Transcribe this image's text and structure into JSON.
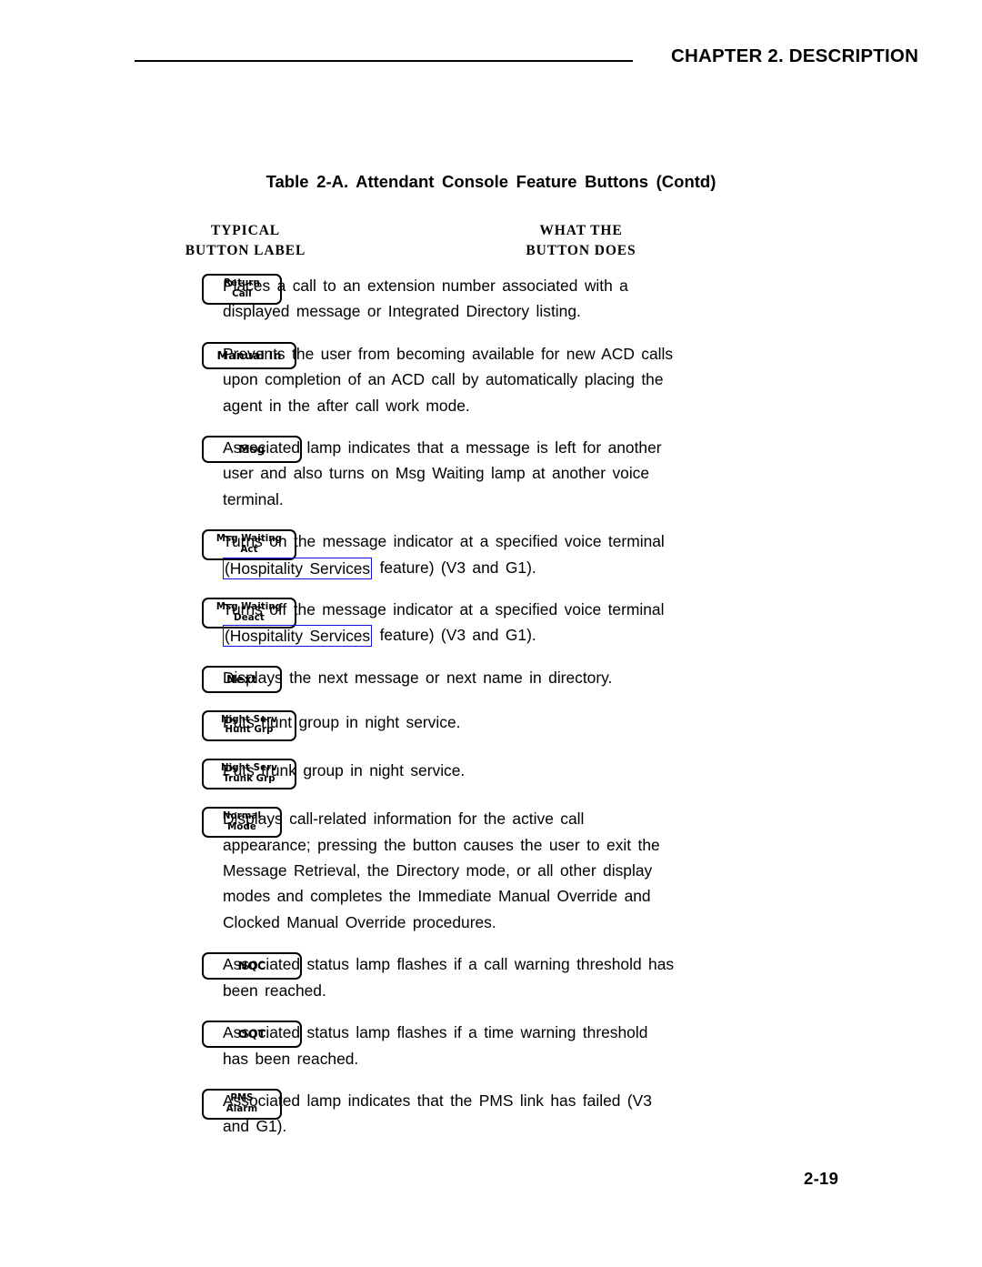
{
  "header": {
    "chapter_title": "CHAPTER 2. DESCRIPTION"
  },
  "table": {
    "caption": "Table 2-A. Attendant Console Feature Buttons (Contd)",
    "columns": {
      "left": "TYPICAL\nBUTTON LABEL",
      "right": "WHAT THE\nBUTTON DOES"
    },
    "link_color": "#1111dd",
    "rows": [
      {
        "button_lines": [
          "Return",
          "Call"
        ],
        "button_style": "two-line",
        "desc_lines": [
          "Places a call to an extension number associated with a",
          "displayed message or Integrated Directory listing."
        ]
      },
      {
        "button_lines": [
          "Manual In"
        ],
        "button_style": "one-line",
        "desc_lines": [
          "Prevents the user from becoming available for new ACD calls",
          "upon completion of an ACD call by automatically placing the",
          "agent in the after call work mode."
        ]
      },
      {
        "button_lines": [
          "Msg"
        ],
        "button_style": "one-line",
        "desc_lines": [
          "Associated lamp indicates that a message is left for another",
          "user and also turns on Msg Waiting lamp at another voice",
          "terminal."
        ]
      },
      {
        "button_lines": [
          "Msg Waiting",
          "Act"
        ],
        "button_style": "two-line",
        "desc_lines": [
          "Turns on the message indicator at a specified voice terminal"
        ],
        "linked_line": {
          "boxed": "(Hospitality Services",
          "after": " feature) (V3 and G1)."
        }
      },
      {
        "button_lines": [
          "Msg Waiting",
          "Deact"
        ],
        "button_style": "two-line",
        "desc_lines": [
          "Turns off the message indicator at a specified voice terminal"
        ],
        "linked_line": {
          "boxed": "(Hospitality Services",
          "after": " feature) (V3 and G1)."
        }
      },
      {
        "button_lines": [
          "Next"
        ],
        "button_style": "one-line",
        "desc_lines": [
          "Displays the next message or next name in directory."
        ]
      },
      {
        "button_lines": [
          "Night Serv",
          "Hunt Grp"
        ],
        "button_style": "two-line",
        "desc_lines": [
          "Puts hunt group in night service."
        ]
      },
      {
        "button_lines": [
          "Night Serv",
          "Trunk Grp"
        ],
        "button_style": "two-line",
        "desc_lines": [
          "Puts trunk group in night service."
        ]
      },
      {
        "button_lines": [
          "Normal",
          "Mode"
        ],
        "button_style": "two-line",
        "desc_lines": [
          "Displays call-related information for the active call",
          "appearance; pressing the button causes the user to exit the",
          "Message Retrieval, the Directory mode, or all other display",
          "modes and completes the Immediate Manual Override and",
          "Clocked Manual Override procedures."
        ]
      },
      {
        "button_lines": [
          "NQC"
        ],
        "button_style": "one-line",
        "desc_lines": [
          "Associated status lamp flashes if a call warning threshold has",
          "been reached."
        ]
      },
      {
        "button_lines": [
          "OQT"
        ],
        "button_style": "one-line",
        "desc_lines": [
          "Associated status lamp flashes if a time warning threshold",
          "has been reached."
        ]
      },
      {
        "button_lines": [
          "PMS",
          "Alarm"
        ],
        "button_style": "two-line",
        "desc_lines": [
          "Associated lamp indicates that the PMS link has failed (V3",
          "and G1)."
        ]
      }
    ]
  },
  "footer": {
    "page_number": "2-19"
  }
}
